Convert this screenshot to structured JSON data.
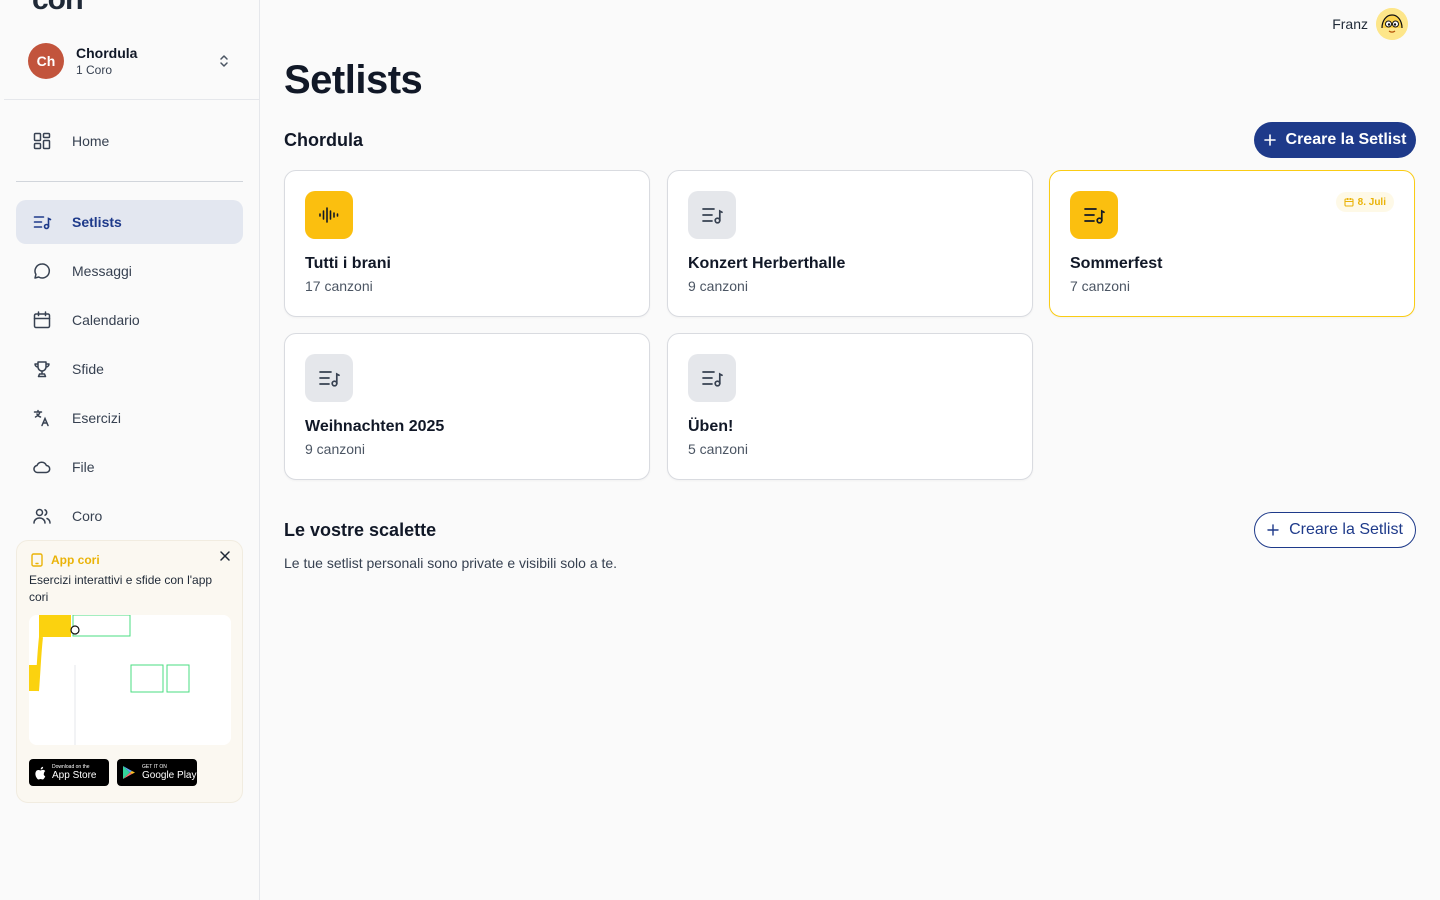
{
  "app": {
    "logo": "cori"
  },
  "org": {
    "initials": "Ch",
    "name": "Chordula",
    "subtitle": "1 Coro"
  },
  "nav": [
    {
      "label": "Home",
      "icon": "grid-icon"
    },
    {
      "label": "Setlists",
      "icon": "setlist-icon",
      "active": true
    },
    {
      "label": "Messaggi",
      "icon": "chat-icon"
    },
    {
      "label": "Calendario",
      "icon": "calendar-icon"
    },
    {
      "label": "Sfide",
      "icon": "trophy-icon"
    },
    {
      "label": "Esercizi",
      "icon": "exercise-icon"
    },
    {
      "label": "File",
      "icon": "cloud-icon"
    },
    {
      "label": "Coro",
      "icon": "users-icon"
    }
  ],
  "promo": {
    "title": "App cori",
    "text": "Esercizi interattivi e sfide con l'app cori",
    "appstore_small": "Download on the",
    "appstore_big": "App Store",
    "googleplay_small": "GET IT ON",
    "googleplay_big": "Google Play"
  },
  "user": {
    "name": "Franz"
  },
  "page": {
    "title": "Setlists"
  },
  "choir_section": {
    "title": "Chordula",
    "create_label": "Creare la Setlist",
    "cards": [
      {
        "name": "Tutti i brani",
        "count": "17 canzoni",
        "icon": "waveform-icon",
        "accent": true
      },
      {
        "name": "Konzert Herberthalle",
        "count": "9 canzoni",
        "icon": "setlist-icon"
      },
      {
        "name": "Sommerfest",
        "count": "7 canzoni",
        "icon": "setlist-icon",
        "accent": true,
        "date": "8. Juli"
      },
      {
        "name": "Weihnachten 2025",
        "count": "9 canzoni",
        "icon": "setlist-icon"
      },
      {
        "name": "Üben!",
        "count": "5 canzoni",
        "icon": "setlist-icon"
      }
    ]
  },
  "personal_section": {
    "title": "Le vostre scalette",
    "create_label": "Creare la Setlist",
    "description": "Le tue setlist personali sono private e visibili solo a te."
  },
  "colors": {
    "primary": "#1e3a8a",
    "accent": "#fbbf0f",
    "avatar": "#c2543c"
  }
}
